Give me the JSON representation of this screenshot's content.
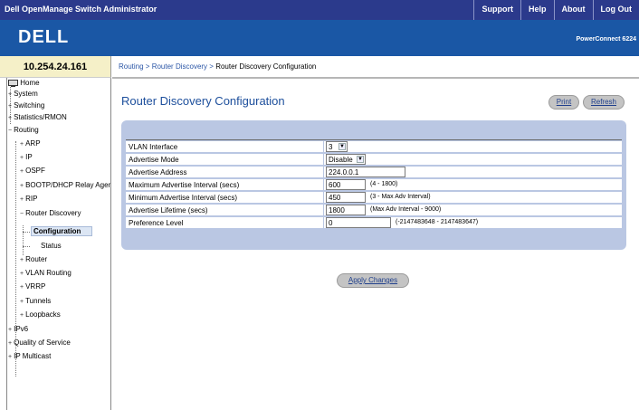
{
  "header": {
    "app_title": "Dell OpenManage Switch Administrator",
    "links": [
      "Support",
      "Help",
      "About",
      "Log Out"
    ],
    "logo": "DELL",
    "product": "PowerConnect 6224"
  },
  "device": {
    "ip": "10.254.24.161"
  },
  "sidebar": {
    "items": [
      {
        "label": "Home",
        "icon": "monitor-icon"
      },
      {
        "label": "System",
        "expander": "+"
      },
      {
        "label": "Switching",
        "expander": "+"
      },
      {
        "label": "Statistics/RMON",
        "expander": "+"
      },
      {
        "label": "Routing",
        "expander": "−"
      },
      {
        "label": "ARP",
        "expander": "+"
      },
      {
        "label": "IP",
        "expander": "+"
      },
      {
        "label": "OSPF",
        "expander": "+"
      },
      {
        "label": "BOOTP/DHCP Relay Agent",
        "expander": "+"
      },
      {
        "label": "RIP",
        "expander": "+"
      },
      {
        "label": "Router Discovery",
        "expander": "−"
      },
      {
        "label": "Configuration",
        "selected": true
      },
      {
        "label": "Status"
      },
      {
        "label": "Router",
        "expander": "+"
      },
      {
        "label": "VLAN Routing",
        "expander": "+"
      },
      {
        "label": "VRRP",
        "expander": "+"
      },
      {
        "label": "Tunnels",
        "expander": "+"
      },
      {
        "label": "Loopbacks",
        "expander": "+"
      },
      {
        "label": "IPv6",
        "expander": "+"
      },
      {
        "label": "Quality of Service",
        "expander": "+"
      },
      {
        "label": "IP Multicast",
        "expander": "+"
      }
    ]
  },
  "breadcrumb": {
    "parts": [
      "Routing",
      "Router Discovery"
    ],
    "separator": " > ",
    "current": "Router Discovery Configuration"
  },
  "page": {
    "title": "Router Discovery Configuration",
    "print_label": "Print",
    "refresh_label": "Refresh",
    "apply_label": "Apply Changes"
  },
  "form": {
    "rows": [
      {
        "label": "VLAN Interface",
        "type": "select",
        "value": "3"
      },
      {
        "label": "Advertise Mode",
        "type": "select",
        "value": "Disable"
      },
      {
        "label": "Advertise Address",
        "type": "text",
        "value": "224.0.0.1",
        "hint": ""
      },
      {
        "label": "Maximum Advertise Interval (secs)",
        "type": "text",
        "value": "600",
        "hint": "(4 - 1800)"
      },
      {
        "label": "Minimum Advertise Interval (secs)",
        "type": "text",
        "value": "450",
        "hint": "(3 - Max Adv Interval)"
      },
      {
        "label": "Advertise Lifetime (secs)",
        "type": "text",
        "value": "1800",
        "hint": "(Max Adv Interval - 9000)"
      },
      {
        "label": "Preference Level",
        "type": "text",
        "value": "0",
        "hint": "(-2147483648 - 2147483647)"
      }
    ]
  },
  "colors": {
    "topbar": "#2b3a8c",
    "banner": "#1a57a5",
    "panel": "#bac7e3",
    "title": "#1d4f9c"
  }
}
